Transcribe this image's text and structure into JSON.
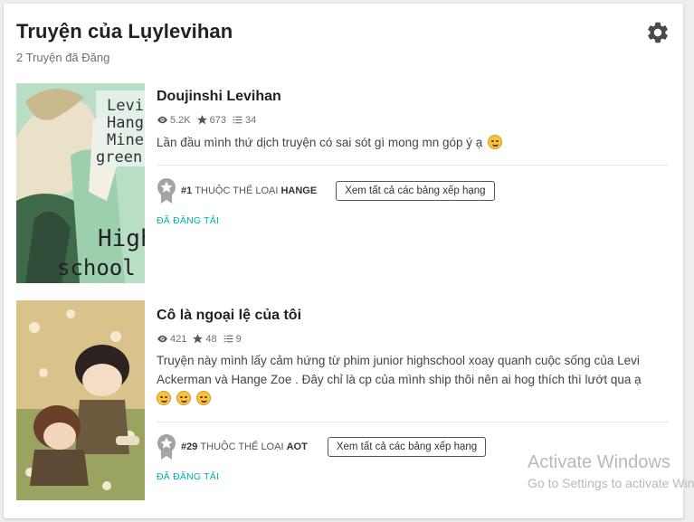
{
  "header": {
    "title": "Truyện của Lụylevihan",
    "subtitle": "2 Truyện đã Đăng",
    "settings_icon": "gear-icon"
  },
  "stories": [
    {
      "title": "Doujinshi Levihan",
      "views": "5.2K",
      "votes": "673",
      "parts": "34",
      "description": "Lần đầu mình thứ dịch truyện có sai sót gì mong mn góp ý ạ",
      "rank_number": "#1",
      "rank_text": "THUỘC THỂ LOẠI",
      "rank_genre": "HANGE",
      "rank_button": "Xem tất cả các bảng xếp hạng",
      "status": "ĐÃ ĐĂNG TẢI",
      "cover_text": [
        "Levi",
        "Hange",
        "Mine",
        "green",
        "High",
        "school"
      ]
    },
    {
      "title": "Cô là ngoại lệ của tôi",
      "views": "421",
      "votes": "48",
      "parts": "9",
      "description": "Truyện này mình lấy cảm hứng từ phim junior highschool xoay quanh cuộc sống của Levi Ackerman và Hange Zoe . Đây chỉ là cp của mình ship thôi nên ai hog thích thì lướt qua ạ",
      "rank_number": "#29",
      "rank_text": "THUỘC THỂ LOẠI",
      "rank_genre": "AOT",
      "rank_button": "Xem tất cả các bảng xếp hạng",
      "status": "ĐÃ ĐĂNG TẢI"
    }
  ],
  "watermark": {
    "line1": "Activate Windows",
    "line2": "Go to Settings to activate Windows."
  },
  "colors": {
    "accent": "#00b2b2",
    "text": "#222222",
    "muted": "#6f6f6f",
    "medal": "#9a9a9a"
  }
}
